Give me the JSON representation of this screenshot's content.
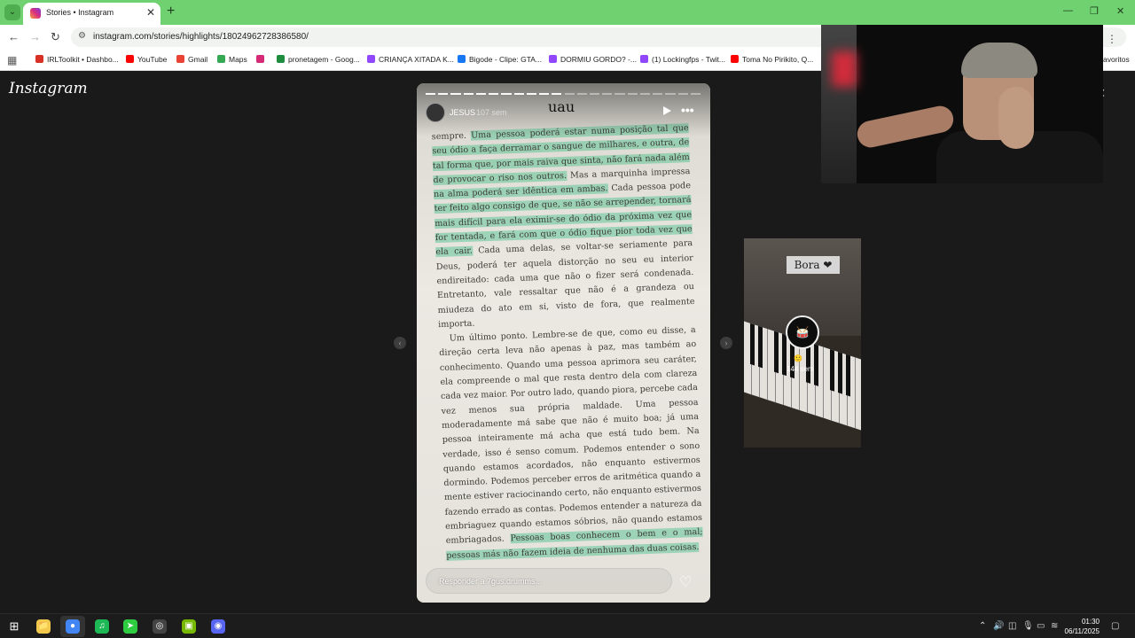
{
  "browser": {
    "tab": {
      "title": "Stories • Instagram",
      "close": "✕"
    },
    "new_tab": "+",
    "menu_icon": "⌄",
    "controls": {
      "minimize": "—",
      "restore": "❐",
      "close": "✕"
    },
    "url": "instagram.com/stories/highlights/18024962728386580/",
    "nav": {
      "back": "←",
      "forward": "→",
      "reload": "↻",
      "site_info": "⚙",
      "menu": "⋮"
    },
    "bookmarks": [
      {
        "label": "IRLToolkit • Dashbo...",
        "color": "#d93025"
      },
      {
        "label": "YouTube",
        "color": "#ff0000"
      },
      {
        "label": "Gmail",
        "color": "#ea4335"
      },
      {
        "label": "Maps",
        "color": "#34a853"
      },
      {
        "label": "",
        "color": "#d62976"
      },
      {
        "label": "pronetagem - Goog...",
        "color": "#1e8e3e"
      },
      {
        "label": "CRIANÇA XITADA K...",
        "color": "#9146ff"
      },
      {
        "label": "Bigode - Clipe: GTA...",
        "color": "#1877f2"
      },
      {
        "label": "DORMIU GORDO? -...",
        "color": "#9146ff"
      },
      {
        "label": "(1) Lockingfps - Twit...",
        "color": "#9146ff"
      },
      {
        "label": "Toma No Pirikito, Q...",
        "color": "#ff0000"
      },
      {
        "label": "avoritos",
        "color": "#f2c94c"
      }
    ]
  },
  "instagram": {
    "logo": "Instagram",
    "close_icon": "‹",
    "story": {
      "username": "JESUS",
      "age": "107 sem",
      "caption": "uau",
      "more": "•••",
      "reply_placeholder": "Responder a 7gus.drumms...",
      "heart": "♡",
      "paragraph1": [
        {
          "t": "sempre. ",
          "h": false
        },
        {
          "t": "Uma pessoa poderá estar numa posição tal que seu ódio a faça derramar o sangue de milhares, e outra, de tal forma que, por mais raiva que sinta, não fará nada além de provocar o riso nos outros.",
          "h": true
        },
        {
          "t": " Mas a marquinha impressa ",
          "h": false
        },
        {
          "t": "na alma poderá ser idêntica em ambas.",
          "h": true
        },
        {
          "t": " Cada pessoa pode ",
          "h": false
        },
        {
          "t": "ter feito algo consigo de que, se não se arrepender, tornará mais difícil para ela eximir-se do ódio da próxima vez que for tentada, e fará com que o ódio fique pior toda vez que ela cair.",
          "h": true
        },
        {
          "t": " Cada uma delas, se voltar-se seriamente para Deus, poderá ter aquela distorção no seu eu interior endireitado: cada uma que não o fizer será condenada. Entretanto, vale ressaltar que não é a grandeza ou miudeza do ato em si, visto de fora, que realmente importa.",
          "h": false
        }
      ],
      "paragraph2": [
        {
          "t": "Um último ponto. Lembre-se de que, como eu disse, a direção certa leva não apenas à paz, mas também ao conhecimento. Quando uma pessoa aprimora seu caráter, ela compreende o mal que resta dentro dela com clareza cada vez maior. Por outro lado, quando piora, percebe cada vez menos sua própria maldade. Uma pessoa moderadamente má sabe que não é muito boa; já uma pessoa inteiramente má acha que está tudo bem. Na verdade, isso é senso comum. Podemos entender o sono quando estamos acordados, não enquanto estivermos dormindo. Podemos perceber erros de aritmética quando a mente estiver raciocinando certo, não enquanto estivermos fazendo errado as contas. Podemos entender a natureza da embriaguez quando estamos sóbrios, não quando estamos embriagados. ",
          "h": false
        },
        {
          "t": "Pessoas boas conhecem o bem e o mal; pessoas más não fazem ideia de nenhuma das duas coisas.",
          "h": true
        }
      ]
    },
    "prev_arrow": "‹",
    "next_arrow": "›",
    "next_story": {
      "sticker": "Bora ❤",
      "avatar_icon": "🥁",
      "age": "144 sem",
      "name_icon": "🙂"
    }
  },
  "taskbar": {
    "start_icon": "⊞",
    "apps": [
      {
        "name": "explorer",
        "glyph": "📁",
        "color": "#f2c94c"
      },
      {
        "name": "chrome",
        "glyph": "●",
        "color": "#4285f4"
      },
      {
        "name": "spotify",
        "glyph": "♫",
        "color": "#1db954"
      },
      {
        "name": "greenapp",
        "glyph": "➤",
        "color": "#2ecc40"
      },
      {
        "name": "obs",
        "glyph": "◎",
        "color": "#444444"
      },
      {
        "name": "nvidia",
        "glyph": "▣",
        "color": "#76b900"
      },
      {
        "name": "discord",
        "glyph": "◉",
        "color": "#5865f2"
      }
    ],
    "time": "01:30",
    "date": "06/11/2025"
  }
}
